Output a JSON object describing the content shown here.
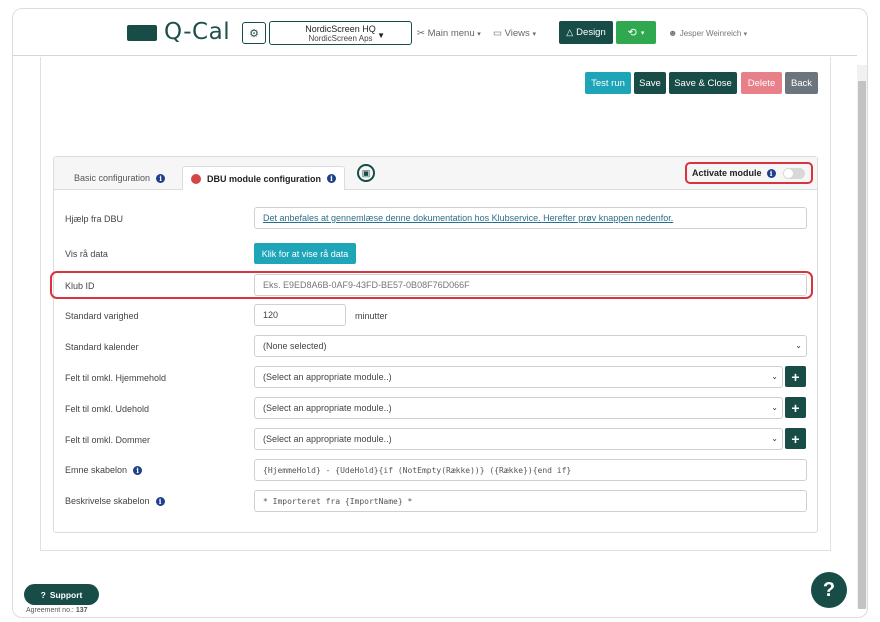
{
  "nav": {
    "logo_text": "Q-Cal",
    "org_name": "NordicScreen HQ",
    "org_sub": "NordicScreen Aps",
    "main_menu": "Main menu",
    "views": "Views",
    "design": "Design",
    "user": "Jesper Weinreich"
  },
  "actions": {
    "test_run": "Test run",
    "save": "Save",
    "save_close": "Save & Close",
    "delete": "Delete",
    "back": "Back"
  },
  "tabs": {
    "basic": "Basic configuration",
    "dbu": "DBU module configuration",
    "activate": "Activate module"
  },
  "form": {
    "help_label": "Hjælp fra DBU",
    "help_text": "Det anbefales at gennemlæse denne dokumentation hos Klubservice. Herefter prøv knappen nedenfor.",
    "raw_label": "Vis rå data",
    "raw_button": "Klik for at vise rå data",
    "club_label": "Klub ID",
    "club_placeholder": "Eks. E9ED8A6B-0AF9-43FD-BE57-0B08F76D066F",
    "duration_label": "Standard varighed",
    "duration_value": "120",
    "duration_unit": "minutter",
    "calendar_label": "Standard kalender",
    "calendar_value": "(None selected)",
    "home_label": "Felt til omkl. Hjemmehold",
    "home_value": "(Select an appropriate module..)",
    "away_label": "Felt til omkl. Udehold",
    "away_value": "(Select an appropriate module..)",
    "ref_label": "Felt til omkl. Dommer",
    "ref_value": "(Select an appropriate module..)",
    "subject_label": "Emne skabelon",
    "subject_value": "{HjemmeHold} - {UdeHold}{if (NotEmpty(Række))} ({Række}){end if}",
    "desc_label": "Beskrivelse skabelon",
    "desc_value": "* Importeret fra {ImportName} *"
  },
  "footer": {
    "support": "Support",
    "agreement_prefix": "Agreement no.:",
    "agreement_no": "137",
    "help": "?"
  },
  "colors": {
    "brand": "#184d47",
    "teal": "#1ea5b8",
    "green": "#2fa84f",
    "danger": "#e8808a",
    "highlight": "#d9333f"
  }
}
